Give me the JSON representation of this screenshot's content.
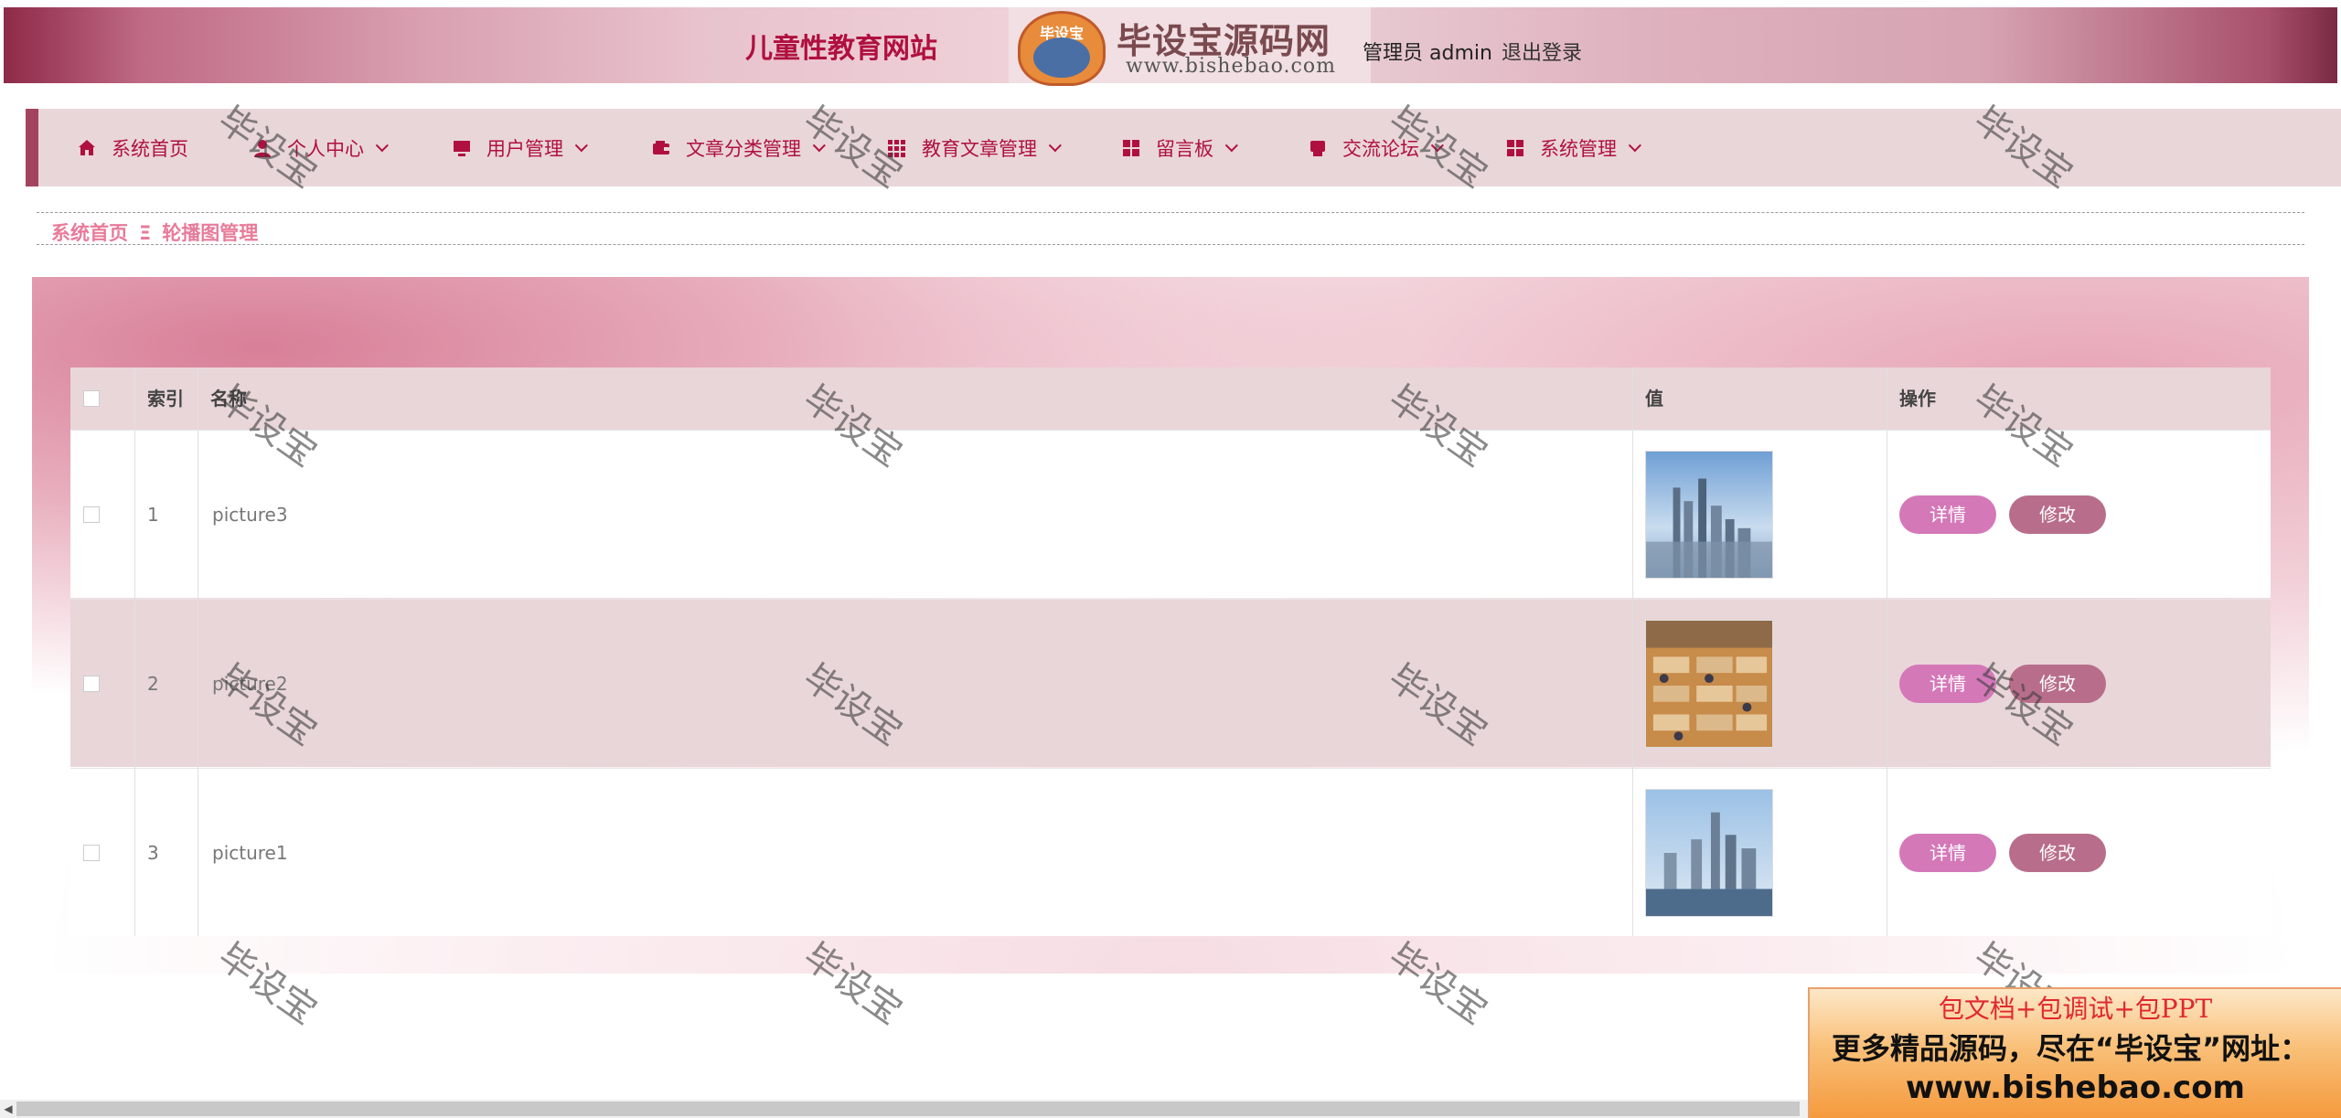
{
  "header": {
    "site_title": "儿童性教育网站",
    "brand_name": "毕设宝源码网",
    "brand_logo_text": "毕设宝",
    "brand_url": "www.bishebao.com",
    "user_label": "管理员 admin",
    "logout_label": "退出登录"
  },
  "nav": {
    "items": [
      {
        "label": "系统首页",
        "icon": "home-icon"
      },
      {
        "label": "个人中心",
        "icon": "user-icon"
      },
      {
        "label": "用户管理",
        "icon": "monitor-icon"
      },
      {
        "label": "文章分类管理",
        "icon": "wallet-icon"
      },
      {
        "label": "教育文章管理",
        "icon": "grid-icon"
      },
      {
        "label": "留言板",
        "icon": "grid-icon"
      },
      {
        "label": "交流论坛",
        "icon": "printer-icon"
      },
      {
        "label": "系统管理",
        "icon": "grid-icon"
      }
    ]
  },
  "breadcrumb": {
    "home": "系统首页",
    "separator": "Ξ",
    "current": "轮播图管理"
  },
  "table": {
    "headers": {
      "index": "索引",
      "name": "名称",
      "value": "值",
      "actions": "操作"
    },
    "rows": [
      {
        "index": "1",
        "name": "picture3",
        "image": "city-skyline-blue"
      },
      {
        "index": "2",
        "name": "picture2",
        "image": "office-interior"
      },
      {
        "index": "3",
        "name": "picture1",
        "image": "city-skyline-water"
      }
    ],
    "detail_label": "详情",
    "edit_label": "修改"
  },
  "watermark": "毕设宝",
  "ad": {
    "line1": "包文档+包调试+包PPT",
    "line2": "更多精品源码，尽在“毕设宝”网址：",
    "line3": "www.bishebao.com"
  },
  "colors": {
    "accent": "#b0103f",
    "nav_bg": "#e9d6d9",
    "breadcrumb": "#e87b9a",
    "detail_button": "#d478b8",
    "edit_button": "#b86e8a"
  }
}
